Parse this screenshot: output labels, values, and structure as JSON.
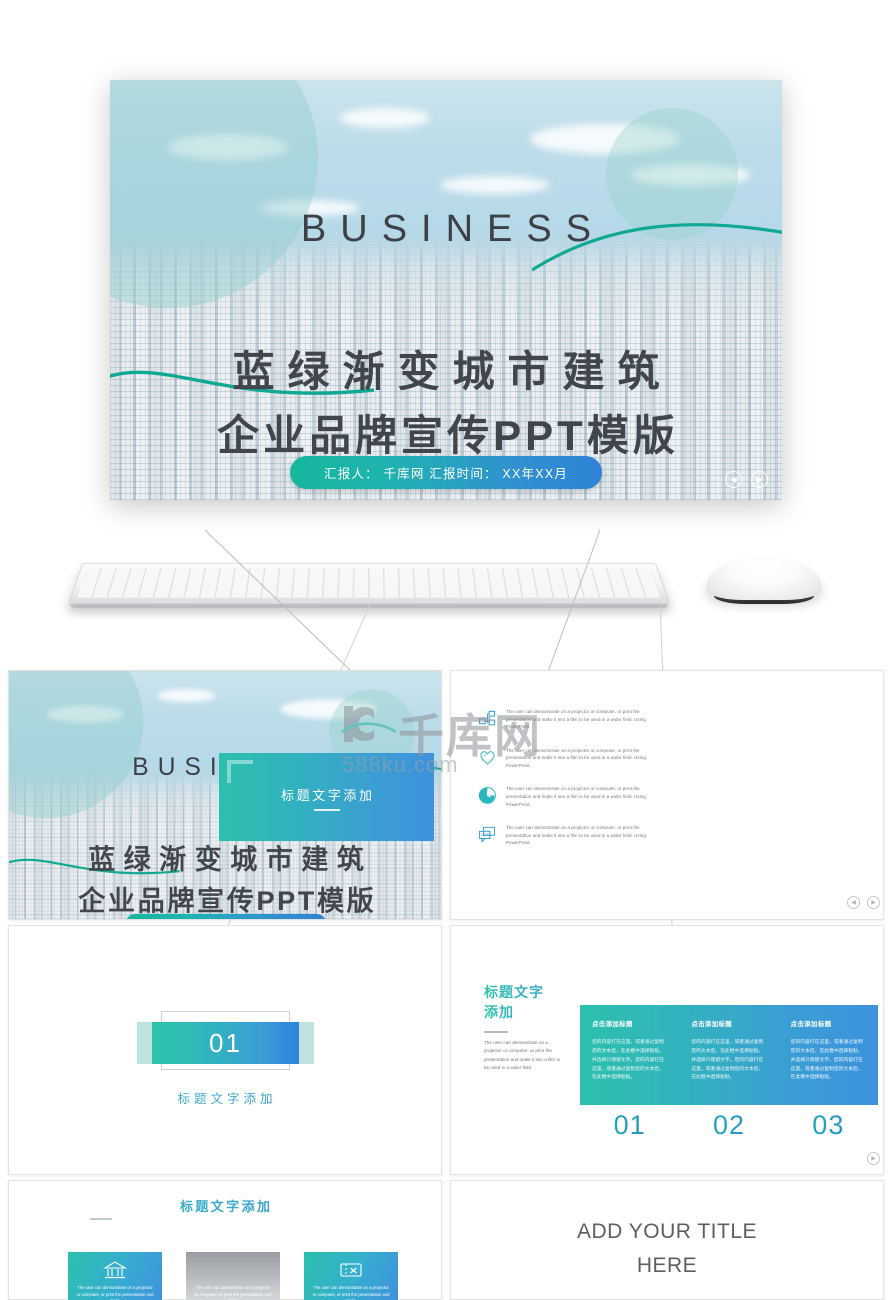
{
  "hero": {
    "english_title": "BUSINESS",
    "title_line1": "蓝绿渐变城市建筑",
    "title_line2": "企业品牌宣传PPT模版",
    "badge": "汇报人： 千库网  汇报时间： XX年XX月",
    "nav_prev": "◀",
    "nav_next": "▶"
  },
  "watermark": {
    "brand_cn": "千库网",
    "url": "588ku.com"
  },
  "colors": {
    "accent_teal": "#2cc0ad",
    "accent_blue": "#3f92dd",
    "title_gray": "#40464b",
    "body_gray": "#70767a"
  },
  "devices": {
    "keyboard": "keyboard",
    "mouse": "mouse"
  },
  "slide2": {
    "rows": [
      {
        "icon": "network-nodes-icon",
        "text": "The user can demonstrate on a projector or computer, or print the presentation and make it into a film to be used in a wider field. Using PowerPoint."
      },
      {
        "icon": "heart-icon",
        "text": "The user can demonstrate on a projector or computer, or print the presentation and make it into a film to be used in a wider field. Using PowerPoint."
      },
      {
        "icon": "clock-icon",
        "text": "The user can demonstrate on a projector or computer, or print the presentation and make it into a film to be used in a wider field. Using PowerPoint."
      },
      {
        "icon": "news-bubble-icon",
        "text": "The user can demonstrate on a projector or computer, or print the presentation and make it into a film to be used in a wider field. Using PowerPoint."
      }
    ],
    "box_title": "标题文字添加",
    "nav_prev": "◀",
    "nav_next": "▶"
  },
  "slide3": {
    "number": "01",
    "subtitle": "标题文字添加"
  },
  "slide4": {
    "title": "标题文字\n添加",
    "description": "The user can demonstrate on a projector or computer, or print the presentation and make it into a film to be used in a wider field.",
    "columns": [
      {
        "heading": "点击添加标题",
        "body": "您的内容打在这里，或者通过复制您的文本后，在此框中选择粘贴，并选择只保留文字。您的内容打在这里，或者通过复制您的文本后，在此框中选择粘贴。"
      },
      {
        "heading": "点击添加标题",
        "body": "您的内容打在这里，或者通过复制您的文本后，在此框中选择粘贴，并选择只保留文字。您的内容打在这里，或者通过复制您的文本后，在此框中选择粘贴。"
      },
      {
        "heading": "点击添加标题",
        "body": "您的内容打在这里，或者通过复制您的文本后，在此框中选择粘贴，并选择只保留文字。您的内容打在这里，或者通过复制您的文本后，在此框中选择粘贴。"
      }
    ],
    "numbers": [
      "01",
      "02",
      "03"
    ],
    "nav_next": "▶"
  },
  "slide5": {
    "title": "标题文字添加",
    "cards": [
      {
        "icon": "bank-icon",
        "text": "The user can demonstrate on a projector or computer, or print the presentation and make"
      },
      {
        "icon": "blank-icon",
        "text": "The user can demonstrate on a projector or computer, or print the presentation and make"
      },
      {
        "icon": "ticket-icon",
        "text": "The user can demonstrate on a projector or computer, or print the presentation and make"
      }
    ]
  },
  "slide6": {
    "title_line1": "ADD YOUR TITLE",
    "title_line2": "HERE"
  }
}
